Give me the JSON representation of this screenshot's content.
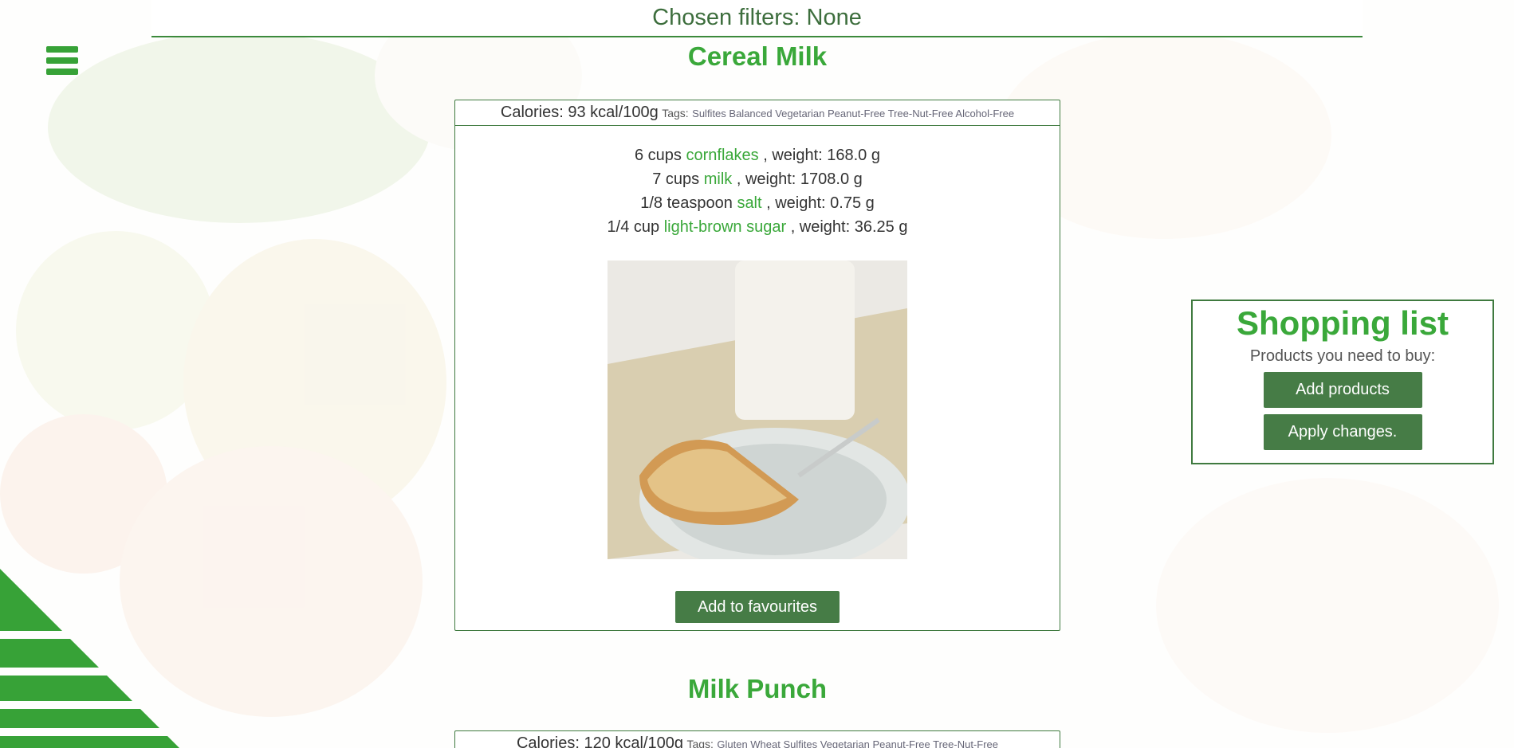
{
  "filters": {
    "label": "Chosen filters: None"
  },
  "recipes": [
    {
      "title": "Cereal Milk",
      "calories": "Calories: 93 kcal/100g",
      "tags_label": "Tags:",
      "tags": "Sulfites Balanced Vegetarian Peanut-Free Tree-Nut-Free Alcohol-Free",
      "ingredients": [
        {
          "qty": "6 cups",
          "name": "cornflakes",
          "weight": ", weight: 168.0 g"
        },
        {
          "qty": "7 cups",
          "name": "milk",
          "weight": ", weight: 1708.0 g"
        },
        {
          "qty": "1/8 teaspoon",
          "name": "salt",
          "weight": ", weight: 0.75 g"
        },
        {
          "qty": "1/4 cup",
          "name": "light-brown sugar",
          "weight": ", weight: 36.25 g"
        }
      ],
      "favourite_button": "Add to favourites"
    },
    {
      "title": "Milk Punch",
      "calories": "Calories: 120 kcal/100g",
      "tags_label": "Tags:",
      "tags": "Gluten Wheat Sulfites Vegetarian Peanut-Free Tree-Nut-Free"
    }
  ],
  "shopping_list": {
    "title": "Shopping list",
    "subtitle": "Products you need to buy:",
    "add_button": "Add products",
    "apply_button": "Apply changes."
  },
  "colors": {
    "accent": "#3aa83a",
    "button": "#467c46",
    "border": "#3f7a3f"
  }
}
